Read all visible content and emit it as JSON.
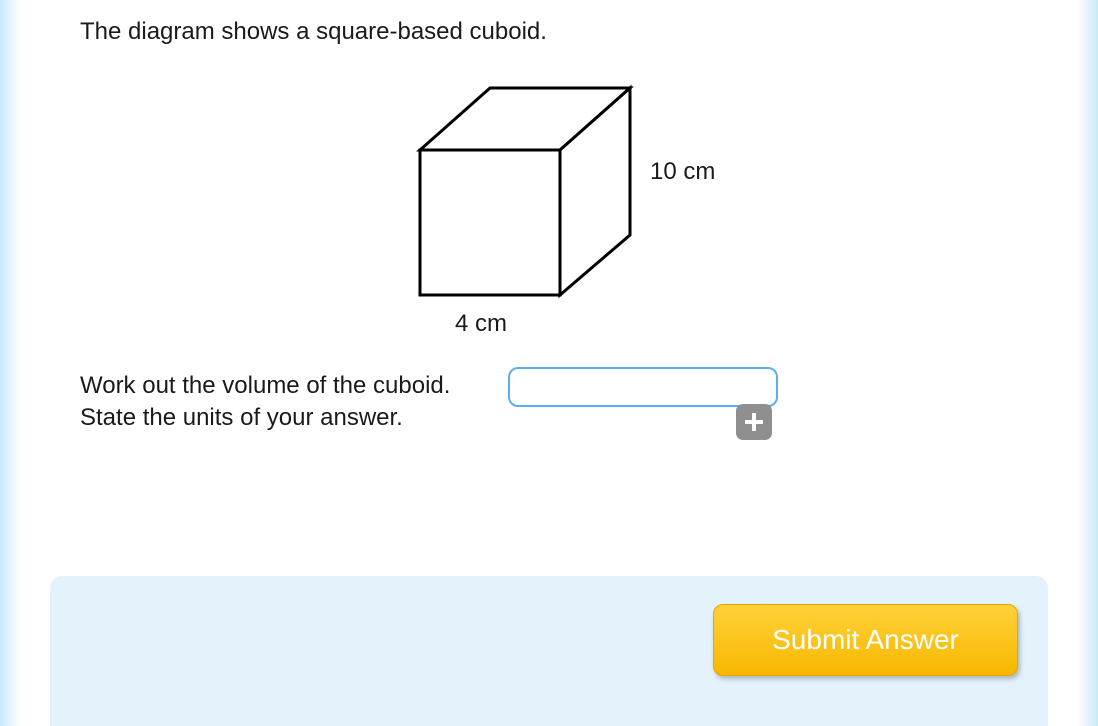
{
  "question": {
    "intro": "The diagram shows a square-based cuboid.",
    "task_line1": "Work out the volume of the cuboid.",
    "task_line2": "State the units of your answer."
  },
  "diagram": {
    "height_label": "10 cm",
    "width_label": "4 cm"
  },
  "answer": {
    "value": "",
    "placeholder": ""
  },
  "buttons": {
    "add_label": "+",
    "submit_label": "Submit Answer"
  }
}
